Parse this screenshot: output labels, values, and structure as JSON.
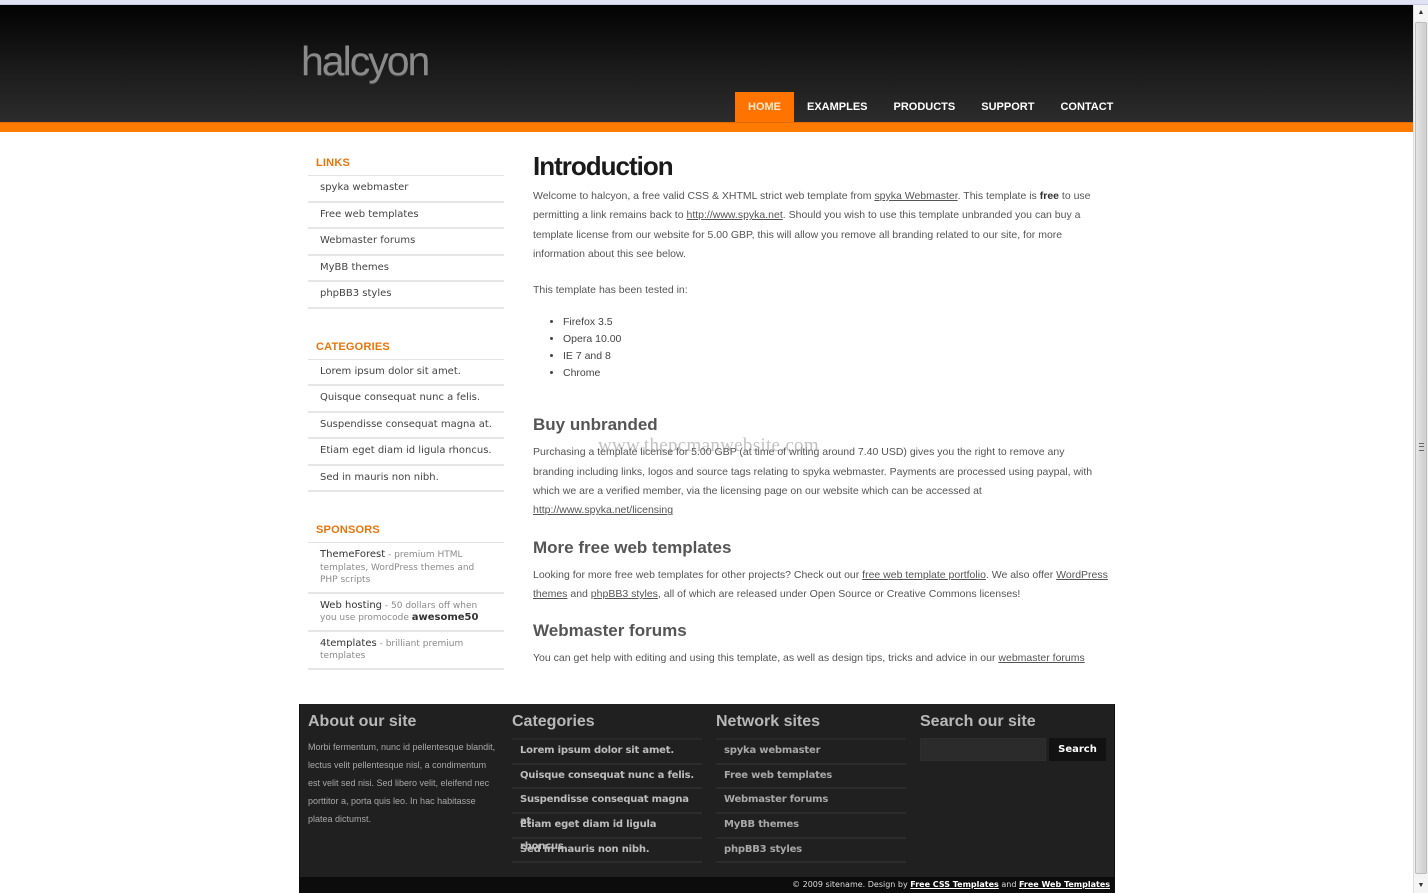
{
  "site": {
    "logo": "halcyon",
    "nav": [
      {
        "label": "HOME",
        "active": true
      },
      {
        "label": "EXAMPLES",
        "active": false
      },
      {
        "label": "PRODUCTS",
        "active": false
      },
      {
        "label": "SUPPORT",
        "active": false
      },
      {
        "label": "CONTACT",
        "active": false
      }
    ],
    "accent_color": "#ff7400"
  },
  "sidebar": {
    "links": {
      "title": "LINKS",
      "items": [
        "spyka webmaster",
        "Free web templates",
        "Webmaster forums",
        "MyBB themes",
        "phpBB3 styles"
      ]
    },
    "categories": {
      "title": "CATEGORIES",
      "items": [
        "Lorem ipsum dolor sit amet.",
        "Quisque consequat nunc a felis.",
        "Suspendisse consequat magna at.",
        "Etiam eget diam id ligula rhoncus.",
        "Sed in mauris non nibh."
      ]
    },
    "sponsors": {
      "title": "SPONSORS",
      "items": [
        {
          "name": "ThemeForest",
          "sep": " - ",
          "desc": "premium HTML templates, WordPress themes and PHP scripts",
          "extra": ""
        },
        {
          "name": "Web hosting",
          "sep": " - ",
          "desc": "50 dollars off when you use promocode ",
          "extra": "awesome50"
        },
        {
          "name": "4templates",
          "sep": " - ",
          "desc": "brilliant premium templates",
          "extra": ""
        }
      ]
    }
  },
  "content": {
    "intro": {
      "title": "Introduction",
      "p1_a": "Welcome to halcyon, a free valid CSS & XHTML strict web template from ",
      "p1_link1": "spyka Webmaster",
      "p1_b": ". This template is ",
      "p1_bold": "free",
      "p1_c": " to use permitting a link remains back to ",
      "p1_link2": "http://www.spyka.net",
      "p1_d": ". Should you wish to use this template unbranded you can buy a template license from our website for 5.00 GBP, this will allow you remove all branding related to our site, for more information about this see below.",
      "tested_label": "This template has been tested in:",
      "browsers": [
        "Firefox 3.5",
        "Opera 10.00",
        "IE 7 and 8",
        "Chrome"
      ]
    },
    "unbranded": {
      "title": "Buy unbranded",
      "text": "Purchasing a template license for 5.00 GBP (at time of writing around 7.40 USD) gives you the right to remove any branding including links, logos and source tags relating to spyka webmaster. Payments are processed using paypal, with which we are a verified member, via the licensing page on our website which can be accessed at ",
      "link": "http://www.spyka.net/licensing"
    },
    "more": {
      "title": "More free web templates",
      "a": "Looking for more free web templates for other projects? Check out our ",
      "link1": "free web template portfolio",
      "b": ". We also offer ",
      "link2": "WordPress themes",
      "c": " and ",
      "link3": "phpBB3 styles",
      "d": ", all of which are released under Open Source or Creative Commons licenses!"
    },
    "forums": {
      "title": "Webmaster forums",
      "a": "You can get help with editing and using this template, as well as design tips, tricks and advice in our ",
      "link": "webmaster forums"
    },
    "watermark": "www.thepcmanwebsite.com"
  },
  "footer": {
    "about": {
      "title": "About our site",
      "text": "Morbi fermentum, nunc id pellentesque blandit, lectus velit pellentesque nisl, a condimentum est velit sed nisi. Sed libero velit, eleifend nec porttitor a, porta quis leo. In hac habitasse platea dictumst."
    },
    "categories": {
      "title": "Categories",
      "items": [
        "Lorem ipsum dolor sit amet.",
        "Quisque consequat nunc a felis.",
        "Suspendisse consequat magna at.",
        "Etiam eget diam id ligula rhoncus.",
        "Sed in mauris non nibh."
      ]
    },
    "network": {
      "title": "Network sites",
      "items": [
        "spyka webmaster",
        "Free web templates",
        "Webmaster forums",
        "MyBB themes",
        "phpBB3 styles"
      ]
    },
    "search": {
      "title": "Search our site",
      "value": "",
      "button": "Search"
    },
    "copyright": {
      "text": "© 2009 sitename. Design by ",
      "link1": "Free CSS Templates",
      "and": " and ",
      "link2": "Free Web Templates"
    }
  },
  "scrollbar": {
    "up": "▲",
    "down": "▼"
  }
}
